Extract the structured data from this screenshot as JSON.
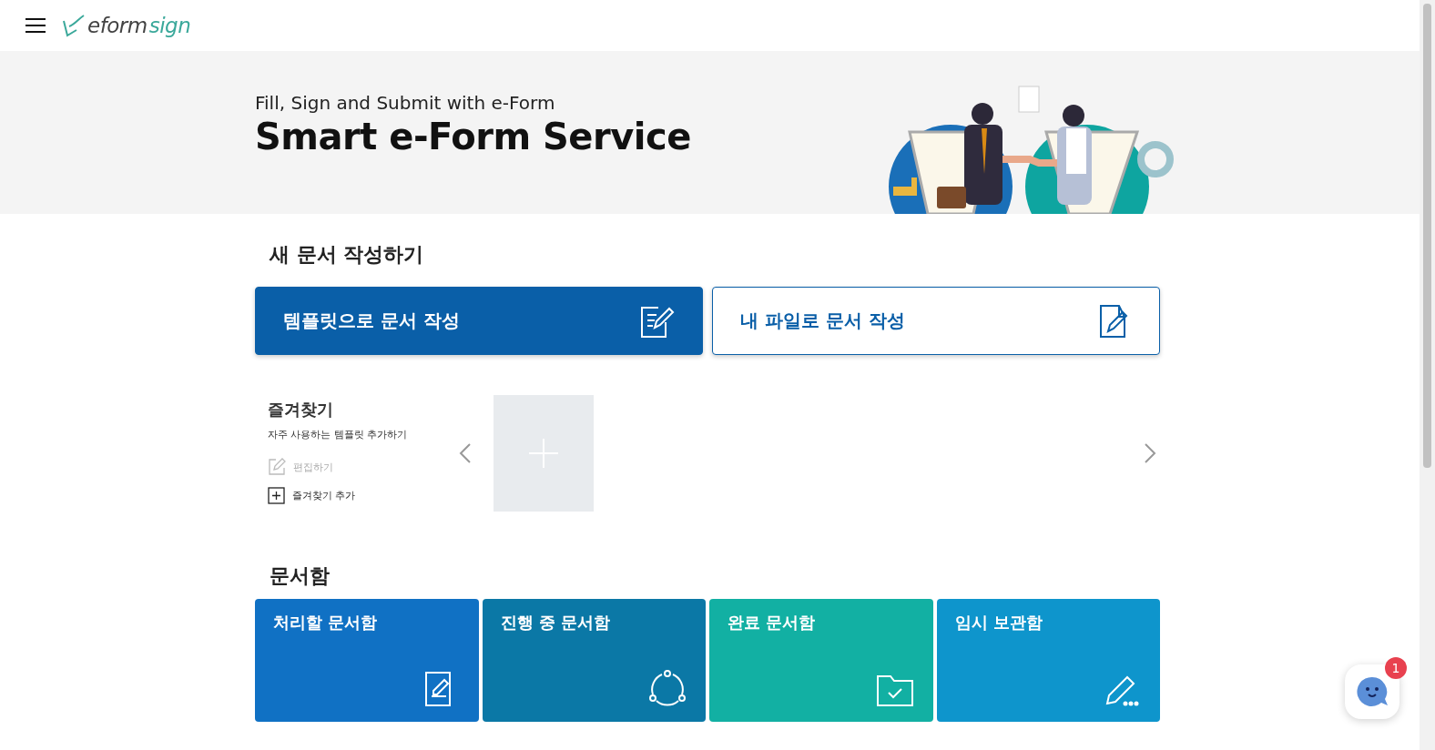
{
  "header": {
    "logo": [
      "eform",
      "sign"
    ]
  },
  "banner": {
    "subtitle": "Fill, Sign and Submit with e-Form",
    "title": "Smart e-Form Service"
  },
  "new_document": {
    "title": "새 문서 작성하기",
    "buttons": [
      {
        "label": "템플릿으로 문서 작성",
        "selected": true
      },
      {
        "label": "내 파일로 문서 작성",
        "selected": false
      }
    ]
  },
  "favorites": {
    "title": "즐겨찾기",
    "description": "자주 사용하는 템플릿 추가하기",
    "actions": [
      {
        "kind": "edit",
        "label": "편집하기",
        "disabled": true
      },
      {
        "kind": "add",
        "label": "즐겨찾기 추가",
        "disabled": false
      }
    ]
  },
  "document_boxes": {
    "title": "문서함",
    "items": [
      {
        "kind": "todo",
        "label": "처리할 문서함",
        "color": "#1071c4"
      },
      {
        "kind": "progress",
        "label": "진행 중 문서함",
        "color": "#0b78a6"
      },
      {
        "kind": "done",
        "label": "완료 문서함",
        "color": "#12b0a3"
      },
      {
        "kind": "draft",
        "label": "임시 보관함",
        "color": "#0e95cc"
      }
    ]
  },
  "chat": {
    "badge": "1"
  }
}
